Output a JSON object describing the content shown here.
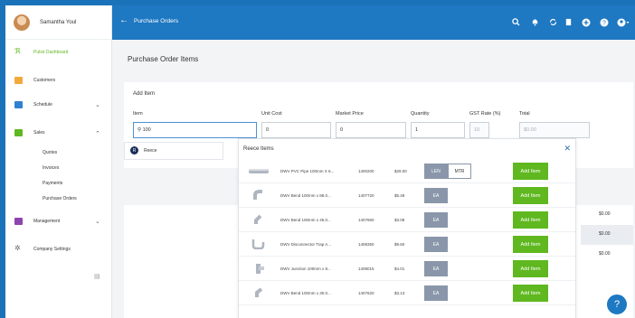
{
  "user": {
    "name": "Samantha Youl"
  },
  "sidebar": {
    "items": [
      {
        "label": "Pulse Dashboard",
        "icon": "pulse-icon"
      },
      {
        "label": "Customers",
        "icon": "customers-icon"
      },
      {
        "label": "Schedule",
        "icon": "calendar-icon"
      },
      {
        "label": "Sales",
        "icon": "sales-icon"
      },
      {
        "label": "Management",
        "icon": "management-icon"
      },
      {
        "label": "Company Settings",
        "icon": "gear-icon"
      }
    ],
    "sales_sub": [
      "Quotes",
      "Invoices",
      "Payments",
      "Purchase Orders"
    ]
  },
  "header": {
    "title": "Purchase Orders"
  },
  "page": {
    "title": "Purchase Order Items"
  },
  "form": {
    "heading": "Add Item",
    "labels": {
      "item": "Item",
      "unit_cost": "Unit Cost",
      "market_price": "Market Price",
      "quantity": "Quantity",
      "gst": "GST Rate (%)",
      "total": "Total"
    },
    "values": {
      "item": "100",
      "unit_cost": "0",
      "market_price": "0",
      "quantity": "1",
      "gst": "10",
      "total": "$0.00"
    }
  },
  "suggestion": {
    "label": "Reece"
  },
  "modal": {
    "title": "Reece Items",
    "rows": [
      {
        "desc": "DWV PVC Pipe 100mm X 6...",
        "code": "1400200",
        "price": "$29.00",
        "units": [
          "LEN",
          "MTR"
        ],
        "button": "Add Item"
      },
      {
        "desc": "DWV Bend 100mm x 88.0...",
        "code": "1407720",
        "price": "$5.49",
        "units": [
          "EA"
        ],
        "button": "Add Item"
      },
      {
        "desc": "DWV Bend 100mm x 45.0...",
        "code": "1407660",
        "price": "$3.08",
        "units": [
          "EA"
        ],
        "button": "Add Item"
      },
      {
        "desc": "DWV Disconnector Trap A...",
        "code": "1408350",
        "price": "$9.60",
        "units": [
          "EA"
        ],
        "button": "Add Item"
      },
      {
        "desc": "DWV Junction 100mm x 8...",
        "code": "1408015",
        "price": "$4.01",
        "units": [
          "EA"
        ],
        "button": "Add Item"
      },
      {
        "desc": "DWV Bend 100mm x 30.0...",
        "code": "1407620",
        "price": "$3.13",
        "units": [
          "EA"
        ],
        "button": "Add Item"
      }
    ]
  },
  "background_values": [
    "$0.00",
    "$0.00",
    "$0.00"
  ],
  "colors": {
    "primary": "#1e78c2",
    "add_button": "#5fb81f",
    "active_nav": "#5fb81f"
  }
}
